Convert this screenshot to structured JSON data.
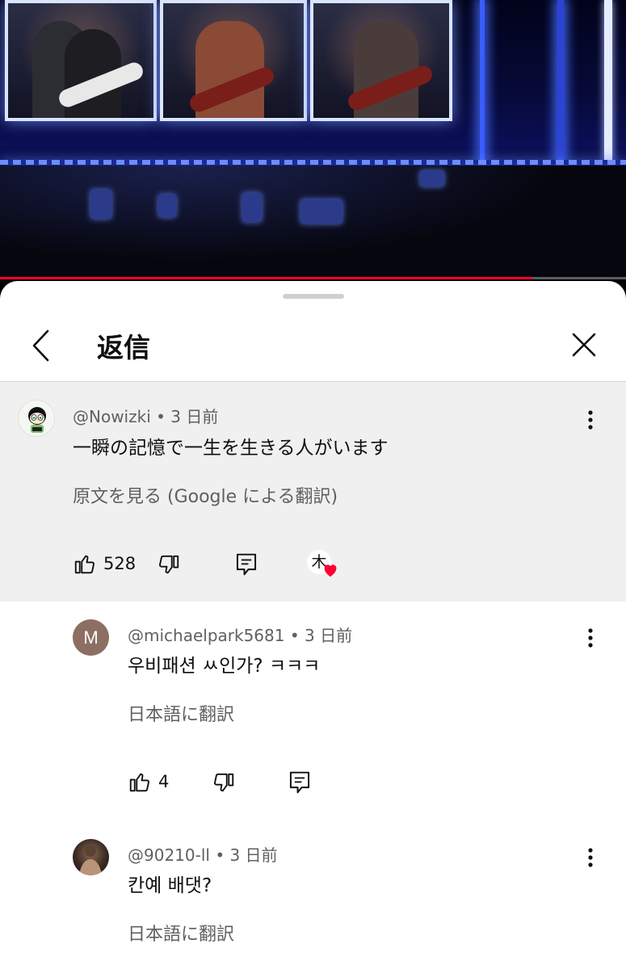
{
  "sheet": {
    "title": "返信"
  },
  "video": {
    "progress_percent": 85
  },
  "comments": [
    {
      "handle": "@Nowizki",
      "time": "3 日前",
      "text": "一瞬の記憶で一生を生きる人がいます",
      "translate_label": "原文を見る (Google による翻訳)",
      "likes": "528",
      "has_creator_heart": true,
      "creator_heart_glyph": "木",
      "avatar_letter": "",
      "avatar_color": "#ffffff"
    },
    {
      "handle": "@michaelpark5681",
      "time": "3 日前",
      "text": "우비패션 ㅆ인가? ㅋㅋㅋ",
      "translate_label": "日本語に翻訳",
      "likes": "4",
      "avatar_letter": "M",
      "avatar_color": "#8d6e63"
    },
    {
      "handle": "@90210-ll",
      "time": "3 日前",
      "text": "칸예 배댓?",
      "translate_label": "日本語に翻訳",
      "avatar_letter": "",
      "avatar_color": "#2a2320"
    }
  ],
  "separator": "•",
  "icons": {
    "back": "chevron-left-icon",
    "close": "close-icon",
    "more": "more-vertical-icon",
    "like": "thumb-up-icon",
    "dislike": "thumb-down-icon",
    "reply": "reply-icon",
    "heart": "heart-icon"
  },
  "colors": {
    "progress": "#ff0033",
    "parent_background": "#f0f0f0",
    "heart": "#ff0033"
  }
}
